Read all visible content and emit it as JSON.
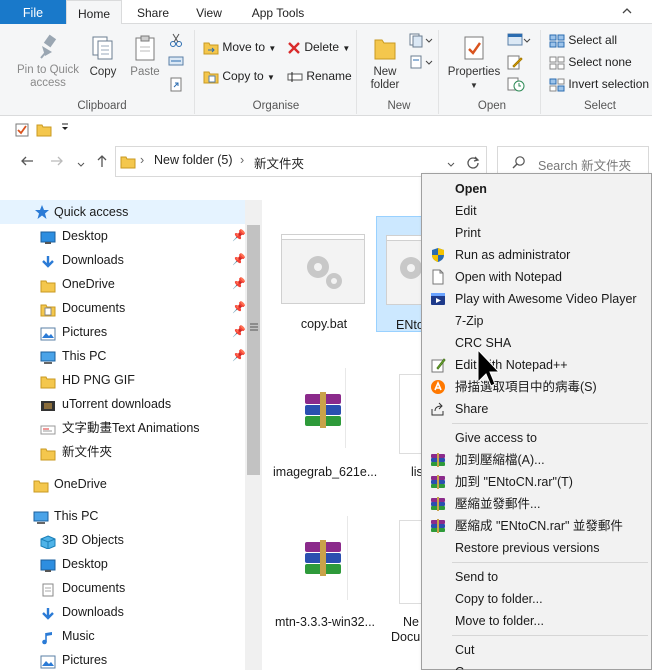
{
  "ribbon": {
    "tabs": [
      "File",
      "Home",
      "Share",
      "View",
      "App Tools"
    ],
    "clipboard": {
      "pin_label_1": "Pin to Quick",
      "pin_label_2": "access",
      "copy": "Copy",
      "paste": "Paste",
      "group": "Clipboard"
    },
    "organise": {
      "move_to": "Move to",
      "copy_to": "Copy to",
      "delete": "Delete",
      "rename": "Rename",
      "group": "Organise"
    },
    "new": {
      "folder_1": "New",
      "folder_2": "folder",
      "group": "New"
    },
    "open": {
      "properties": "Properties",
      "group": "Open"
    },
    "select": {
      "select_all": "Select all",
      "select_none": "Select none",
      "invert": "Invert selection",
      "group": "Select"
    }
  },
  "address": {
    "crumb1": "New folder (5)",
    "crumb2": "新文件夾",
    "search_placeholder": "Search 新文件夾"
  },
  "nav": {
    "quick_access": "Quick access",
    "items": [
      {
        "label": "Desktop",
        "icon": "desktop-icon",
        "pinned": true
      },
      {
        "label": "Downloads",
        "icon": "download-icon",
        "pinned": true
      },
      {
        "label": "OneDrive",
        "icon": "folder-icon",
        "pinned": true
      },
      {
        "label": "Documents",
        "icon": "documents-icon",
        "pinned": true
      },
      {
        "label": "Pictures",
        "icon": "pictures-icon",
        "pinned": true
      },
      {
        "label": "This PC",
        "icon": "pc-icon",
        "pinned": true
      },
      {
        "label": "HD PNG GIF",
        "icon": "folder-icon",
        "pinned": false
      },
      {
        "label": "uTorrent downloads",
        "icon": "film-icon",
        "pinned": false
      },
      {
        "label": "文字動畫Text Animations",
        "icon": "card-icon",
        "pinned": false
      },
      {
        "label": "新文件夾",
        "icon": "folder-icon",
        "pinned": false
      }
    ],
    "onedrive": "OneDrive",
    "this_pc": "This PC",
    "pc_items": [
      "3D Objects",
      "Desktop",
      "Documents",
      "Downloads",
      "Music",
      "Pictures"
    ]
  },
  "files": [
    {
      "name": "copy.bat"
    },
    {
      "name": "ENto"
    },
    {
      "name": "imagegrab_621e..."
    },
    {
      "name": "lis"
    },
    {
      "name": "mtn-3.3.3-win32..."
    },
    {
      "name": "Ne"
    },
    {
      "name": "Docu"
    }
  ],
  "context_menu": {
    "open": "Open",
    "edit": "Edit",
    "print": "Print",
    "run_as_admin": "Run as administrator",
    "open_notepad": "Open with Notepad",
    "play_video": "Play with Awesome Video Player",
    "seven_zip": "7-Zip",
    "crc_sha": "CRC SHA",
    "edit_npp": "Edit with Notepad++",
    "scan_virus": "掃描選取項目中的病毒(S)",
    "share": "Share",
    "give_access": "Give access to",
    "add_archive": "加到壓縮檔(A)...",
    "add_rar": "加到 \"ENtoCN.rar\"(T)",
    "compress_email": "壓縮並發郵件...",
    "compress_rar_email": "壓縮成 \"ENtoCN.rar\" 並發郵件",
    "restore": "Restore previous versions",
    "send_to": "Send to",
    "copy_folder": "Copy to folder...",
    "move_folder": "Move to folder...",
    "cut": "Cut",
    "copy_partial": "C"
  },
  "colors": {
    "file_tab": "#1979ca",
    "selection": "#cce8ff",
    "menu_bg": "#f2f2f2"
  }
}
